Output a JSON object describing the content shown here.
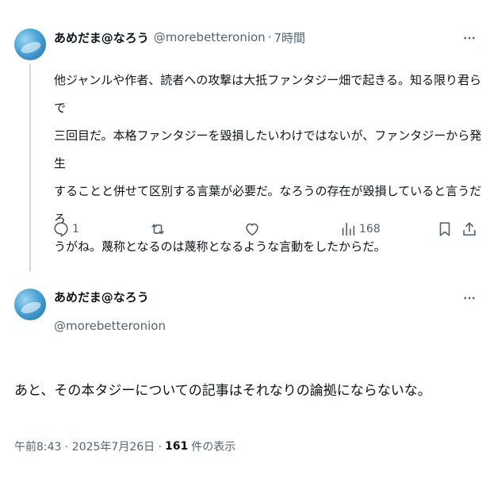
{
  "tweet1": {
    "author_name": "あめだま@なろう",
    "handle": "@morebetteronion",
    "separator": "·",
    "time": "7時間",
    "body": "他ジャンルや作者、読者への攻撃は大抵ファンタジー畑で起きる。知る限り君らで\n三回目だ。本格ファンタジーを毀損したいわけではないが、ファンタジーから発生\nすることと併せて区別する言葉が必要だ。なろうの存在が毀損していると言うだろ\nうがね。蔑称となるのは蔑称となるような言動をしたからだ。",
    "actions": {
      "reply_count": "1",
      "retweet_count": "",
      "like_count": "",
      "views_count": "168"
    }
  },
  "tweet2": {
    "author_name": "あめだま@なろう",
    "handle": "@morebetteronion",
    "body": "あと、その本タジーについての記事はそれなりの論拠にならないな。",
    "timestamp": "午前8:43 · 2025年7月26日 ·",
    "views_count": "161",
    "views_label": "件の表示"
  },
  "icons": {
    "more": "more-horizontal-icon",
    "reply": "reply-icon",
    "retweet": "retweet-icon",
    "like": "heart-icon",
    "views": "views-icon",
    "bookmark": "bookmark-icon",
    "share": "share-icon"
  },
  "colors": {
    "text_primary": "#0f1419",
    "text_secondary": "#536471",
    "thread_line": "#cfd9de"
  }
}
